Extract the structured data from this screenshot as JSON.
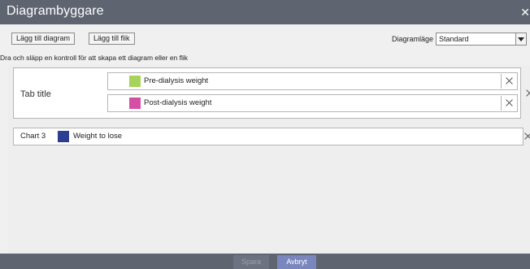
{
  "window": {
    "title": "Diagrambyggare"
  },
  "toolbar": {
    "add_chart_label": "Lägg till diagram",
    "add_tab_label": "Lägg till flik",
    "mode_label": "Diagramläge",
    "mode_value": "Standard"
  },
  "hint": "Dra och släpp en kontroll för att skapa ett diagram eller en flik",
  "tab": {
    "title": "Tab title",
    "items": [
      {
        "label": "Pre-dialysis weight",
        "color": "#a6d35a"
      },
      {
        "label": "Post-dialysis weight",
        "color": "#d64fa6"
      }
    ]
  },
  "chart": {
    "name": "Chart 3",
    "item_label": "Weight to lose",
    "color": "#2d3d8f"
  },
  "footer": {
    "save_label": "Spara",
    "cancel_label": "Avbryt"
  },
  "colors": {
    "titlebar": "#5e6470",
    "footer": "#5e6470",
    "cancel_button": "#7a87bf"
  }
}
